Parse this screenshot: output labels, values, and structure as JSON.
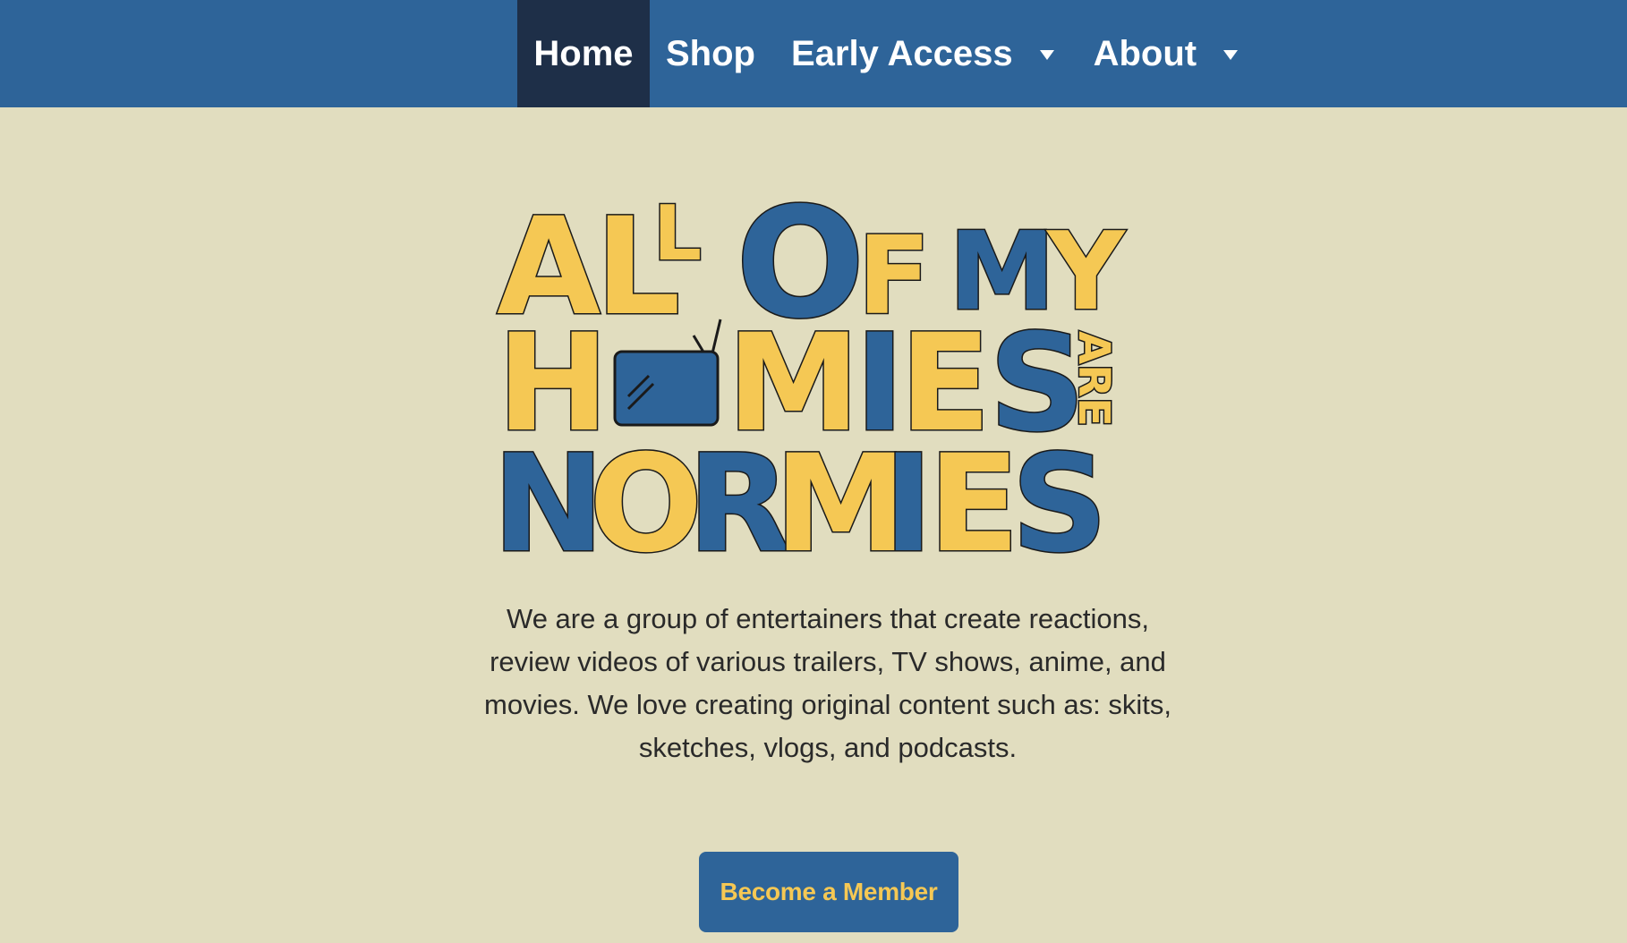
{
  "nav": {
    "items": [
      {
        "label": "Home",
        "active": true
      },
      {
        "label": "Shop"
      },
      {
        "label": "Early Access",
        "has_dropdown": true
      },
      {
        "label": "About",
        "has_dropdown": true
      }
    ]
  },
  "logo": {
    "lines": [
      "ALL OF MY",
      "HOMIES ARE",
      "NORMIES"
    ],
    "icon": "tv-icon"
  },
  "intro_text": "We are a group of entertainers that create reactions, review videos of various trailers, TV shows, anime, and movies. We love creating original content such as: skits, sketches, vlogs, and podcasts.",
  "cta_label": "Become a Member",
  "colors": {
    "nav_bg": "#2e6499",
    "nav_active_bg": "#1e2f48",
    "page_bg": "#e1ddbf",
    "logo_yellow": "#f5c854",
    "logo_blue": "#2e6499",
    "cta_text": "#f5c854"
  }
}
